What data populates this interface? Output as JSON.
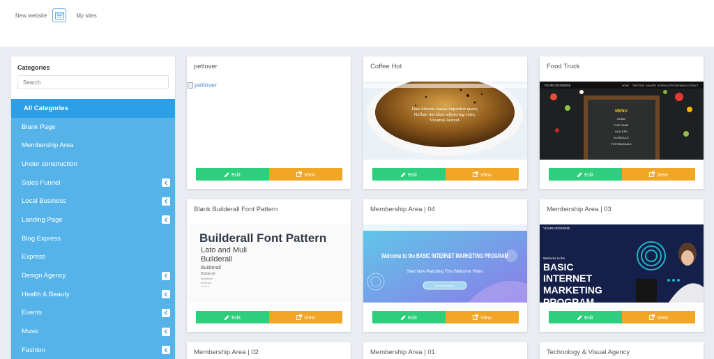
{
  "topbar": {
    "new_website": "New website",
    "my_sites": "My sites"
  },
  "sidebar": {
    "title": "Categories",
    "search_placeholder": "Search",
    "items": [
      {
        "label": "All Categories",
        "active": true,
        "arrow": false
      },
      {
        "label": "Blank Page",
        "arrow": false
      },
      {
        "label": "Membership Area",
        "arrow": false
      },
      {
        "label": "Under construction",
        "arrow": false
      },
      {
        "label": "Sales Funnel",
        "arrow": true
      },
      {
        "label": "Local Business",
        "arrow": true
      },
      {
        "label": "Landing Page",
        "arrow": true
      },
      {
        "label": "Blog Express",
        "arrow": false
      },
      {
        "label": "Express",
        "arrow": false
      },
      {
        "label": "Design Agency",
        "arrow": true
      },
      {
        "label": "Health & Beauty",
        "arrow": true
      },
      {
        "label": "Events",
        "arrow": true
      },
      {
        "label": "Music",
        "arrow": true
      },
      {
        "label": "Fashion",
        "arrow": true
      }
    ]
  },
  "buttons": {
    "edit": "Edit",
    "view": "View"
  },
  "cards": [
    {
      "title": "petlover",
      "thumb_alt": "petlover"
    },
    {
      "title": "Coffee Hot",
      "thumb_text": [
        "Duis lobortis massa imperdiet quam,",
        "Nullam tincidunt adipiscing enim,",
        "Vivamus laoreet."
      ]
    },
    {
      "title": "Food Truck",
      "thumb_logo": "YOURLOGOHERE",
      "thumb_nav": [
        "HOME",
        "THE FOOD",
        "GALLERY",
        "SCHEDULE",
        "TESTIMONIALS",
        "CONTACT"
      ],
      "menu_title": "MENU",
      "menu_items": [
        "HOME",
        "THE FOOD",
        "GALLERY",
        "SCHEDULE",
        "TESTIMONIALS"
      ]
    },
    {
      "title": "Blank Builderall Font Pattern",
      "thumb_lines": [
        "Builderall Font Pattern",
        "Lato and Muli",
        "Builderall",
        "Builderall",
        "Builderall",
        "Builderall",
        "Builderall",
        "Builderall"
      ]
    },
    {
      "title": "Membership Area | 04",
      "thumb_heading": "Welcome to the BASIC INTERNET MARKETING PROGRAM",
      "thumb_sub": "Start Now Watching This Welcome Video",
      "thumb_button": "GET STARTED"
    },
    {
      "title": "Membership Area | 03",
      "thumb_logo": "YOURLOGOHERE",
      "thumb_small": "Welcome to the",
      "thumb_heading": [
        "BASIC",
        "INTERNET",
        "MARKETING",
        "PROGRAM"
      ]
    },
    {
      "title": "Membership Area | 02"
    },
    {
      "title": "Membership Area | 01"
    },
    {
      "title": "Technology & Visual Agency"
    }
  ],
  "colors": {
    "sidebar_blue": "#55b3ea",
    "sidebar_active": "#2c9fe8",
    "edit_green": "#2ecf7c",
    "view_orange": "#f2a625"
  },
  "icons": {
    "edit": "pencil-icon",
    "view": "external-link-icon",
    "arrow": "chevron-left-icon",
    "site": "browser-window-icon"
  }
}
